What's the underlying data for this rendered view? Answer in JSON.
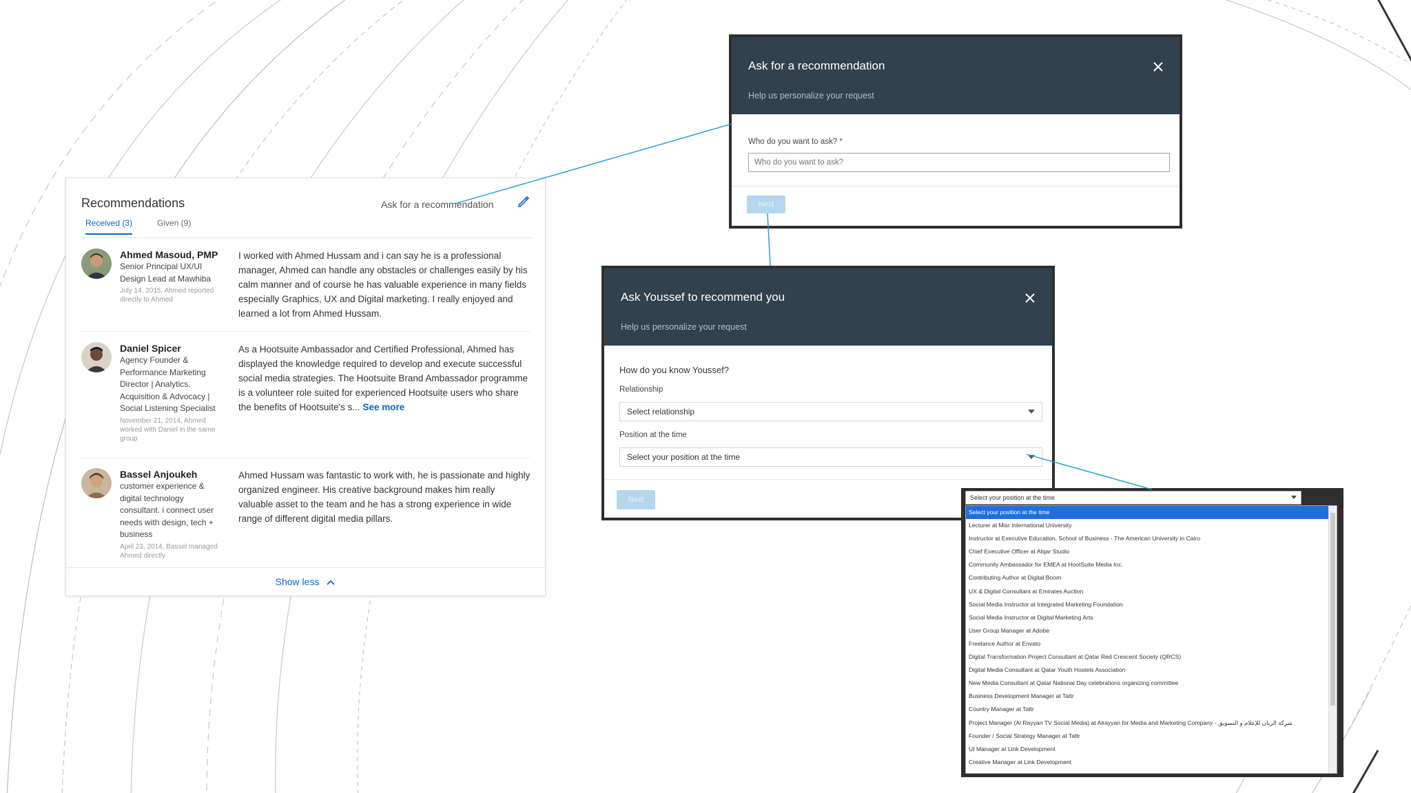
{
  "recommendations": {
    "title": "Recommendations",
    "ask_link": "Ask for a recommendation",
    "tabs": [
      {
        "label": "Received (3)",
        "active": true
      },
      {
        "label": "Given (9)",
        "active": false
      }
    ],
    "items": [
      {
        "name": "Ahmed Masoud, PMP",
        "title": "Senior Principal UX/UI Design Lead at Mawhiba",
        "meta": "July 14, 2015, Ahmed reported directly to Ahmed",
        "text": "I worked with Ahmed Hussam and i can say he is a professional manager, Ahmed can handle any obstacles or challenges easily by his calm manner and of course he has valuable experience in many fields especially Graphics, UX and Digital marketing. I really enjoyed and learned a lot from Ahmed Hussam.",
        "see_more": ""
      },
      {
        "name": "Daniel Spicer",
        "title": "Agency Founder & Performance Marketing Director | Analytics, Acquisition & Advocacy | Social Listening Specialist",
        "meta": "November 21, 2014, Ahmed worked with Daniel in the same group",
        "text": "As a Hootsuite Ambassador and Certified Professional, Ahmed has displayed the knowledge required to develop and execute successful social media strategies. The Hootsuite Brand Ambassador programme is a volunteer role suited for experienced Hootsuite users who share the benefits of Hootsuite's s... ",
        "see_more": "See more"
      },
      {
        "name": "Bassel Anjoukeh",
        "title": "customer experience & digital technology consultant. i connect user needs with design, tech + business",
        "meta": "April 23, 2014, Bassel managed Ahmed directly",
        "text": "Ahmed Hussam was fantastic to work with, he is passionate and highly organized engineer. His creative background makes him really valuable asset to the team and he has a strong experience in wide range of different digital media pillars.",
        "see_more": ""
      }
    ],
    "show_less": "Show less"
  },
  "ask_modal": {
    "title": "Ask for a recommendation",
    "subtitle": "Help us personalize your request",
    "field_label": "Who do you want to ask?",
    "required_mark": "*",
    "placeholder": "Who do you want to ask?",
    "button": "Next"
  },
  "youssef_modal": {
    "title": "Ask Youssef to recommend you",
    "subtitle": "Help us personalize your request",
    "question": "How do you know Youssef?",
    "relationship_label": "Relationship",
    "relationship_value": "Select relationship",
    "position_label": "Position at the time",
    "position_value": "Select your position at the time",
    "button": "Next"
  },
  "dropdown": {
    "value": "Select your position at the time",
    "options": [
      "Select your position at the time",
      "Lecturer at Misr International University",
      "Instructor at Executive Education, School of Business - The American University in Cairo",
      "Chief Executive Officer at Afqar Studio",
      "Community Ambassador for EMEA at HootSuite Media Inc.",
      "Contributing Author at Digital Boom",
      "UX & Digital Consultant at Emirates Auction",
      "Social Media Instructor at Integrated Marketing Foundation",
      "Social Media Instructor at Digital Marketing Arts",
      "User Group Manager at Adobe",
      "Freelance Author at Envato",
      "Digital Transformation Project Consultant at Qatar Red Crescent Society (QRCS)",
      "Digital Media Consultant at Qatar Youth Hostels Association",
      "New Media Consultant at Qatar National Day celebrations organizing committee",
      "Business Development Manager at Tattr",
      "Country Manager at Tattr",
      "Project Manager (Al Rayyan TV Social Media) at Alrayyan for Media and Marketing Company - شركة الريان للإعلام و التسويق",
      "Founder / Social Strategy Manager at Tattr",
      "UI Manager at Link Development",
      "Creative Manager at Link Development"
    ],
    "selected_index": 0
  },
  "colors": {
    "modal_header": "#31414d",
    "link_blue": "#0a66c2",
    "connector": "#1a9bd1",
    "selected_option": "#1e6fe0"
  }
}
